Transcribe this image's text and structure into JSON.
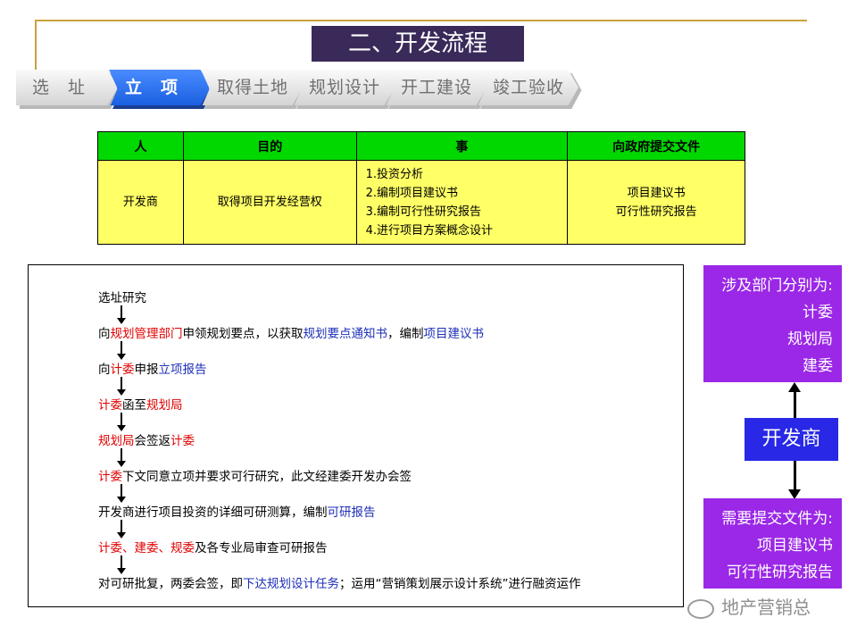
{
  "title": "二、开发流程",
  "steps": [
    {
      "label": "选　址"
    },
    {
      "label": "立　项"
    },
    {
      "label": "取得土地"
    },
    {
      "label": "规划设计"
    },
    {
      "label": "开工建设"
    },
    {
      "label": "竣工验收"
    }
  ],
  "table": {
    "headers": [
      "人",
      "目的",
      "事",
      "向政府提交文件"
    ],
    "person": "开发商",
    "purpose": "取得项目开发经营权",
    "tasks": [
      "1.投资分析",
      "2.编制项目建议书",
      "3.编制可行性研究报告",
      "4.进行项目方案概念设计"
    ],
    "docs": [
      "项目建议书",
      "可行性研究报告"
    ]
  },
  "flow": {
    "s1": "选址研究",
    "s2": [
      "向",
      "规划管理部门",
      "申领规划要点，以获取",
      "规划要点通知书",
      "，编制",
      "项目建议书"
    ],
    "s3": [
      "向",
      "计委",
      "申报",
      "立项报告"
    ],
    "s4": [
      "计委",
      "函至",
      "规划局"
    ],
    "s5": [
      "规划局",
      "会签返",
      "计委"
    ],
    "s6": [
      "计委",
      "下文同意立项并要求可行研究，此文经建委开发办会签"
    ],
    "s7": [
      "开发商进行项目投资的详细可研测算，编制",
      "可研报告"
    ],
    "s8": [
      "计委、建委、规委",
      "及各专业局审查可研报告"
    ],
    "s9": [
      "对可研批复，两委会签，即",
      "下达规划设计任务",
      "；运用“营销策划展示设计系统”进行融资运作"
    ]
  },
  "side": {
    "depts_title": "涉及部门分别为:",
    "depts": [
      "计委",
      "规划局",
      "建委"
    ],
    "developer": "开发商",
    "files_title": "需要提交文件为:",
    "files": [
      "项目建议书",
      "可行性研究报告"
    ]
  },
  "watermark": "地产营销总"
}
